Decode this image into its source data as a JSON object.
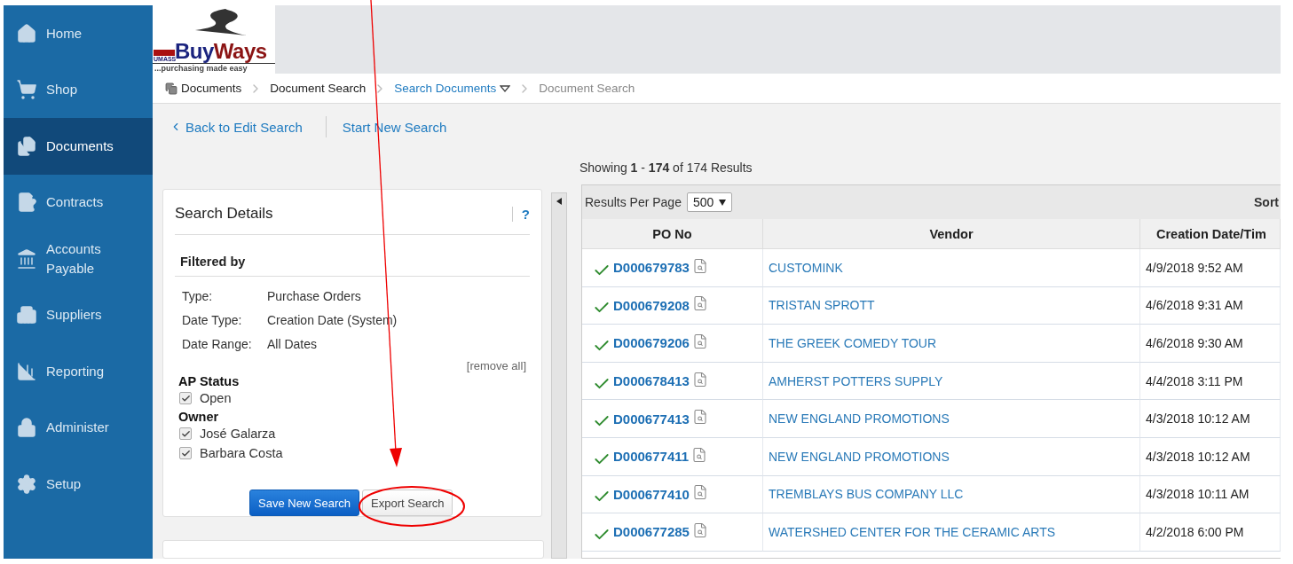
{
  "sidebar": {
    "items": [
      {
        "label": "Home",
        "selected": false
      },
      {
        "label": "Shop",
        "selected": false
      },
      {
        "label": "Documents",
        "selected": true
      },
      {
        "label": "Contracts",
        "selected": false
      },
      {
        "label": "Accounts Payable",
        "selected": false
      },
      {
        "label": "Suppliers",
        "selected": false
      },
      {
        "label": "Reporting",
        "selected": false
      },
      {
        "label": "Administer",
        "selected": false
      },
      {
        "label": "Setup",
        "selected": false
      }
    ]
  },
  "logo": {
    "mark": "UMASS",
    "name_1": "Buy",
    "name_2": "Ways",
    "tagline": "...purchasing made easy"
  },
  "breadcrumb": [
    {
      "label": "Documents",
      "kind": "root"
    },
    {
      "label": "Document Search",
      "kind": "plain"
    },
    {
      "label": "Search Documents",
      "kind": "menu"
    },
    {
      "label": "Document Search",
      "kind": "current"
    }
  ],
  "actions": {
    "back": "Back to Edit Search",
    "new": "Start New Search"
  },
  "search_details": {
    "title": "Search Details",
    "help": "?",
    "filtered_by": "Filtered by",
    "filters": [
      {
        "label": "Type:",
        "value": "Purchase Orders"
      },
      {
        "label": "Date Type:",
        "value": "Creation Date (System)"
      },
      {
        "label": "Date Range:",
        "value": "All Dates"
      }
    ],
    "remove_all": "[remove all]",
    "groups": [
      {
        "title": "AP Status",
        "options": [
          {
            "label": "Open",
            "checked": true
          }
        ]
      },
      {
        "title": "Owner",
        "options": [
          {
            "label": "José Galarza",
            "checked": true
          },
          {
            "label": "Barbara Costa",
            "checked": true
          }
        ]
      }
    ],
    "buttons": [
      {
        "label": "Save New Search",
        "kind": "primary"
      },
      {
        "label": "Export Search",
        "kind": "secondary"
      }
    ]
  },
  "results": {
    "summary": "Showing **1** - **174** of 174 Results",
    "per_page_label": "Results Per Page",
    "per_page": "500",
    "sort": "Sort",
    "columns": [
      "PO No",
      "Vendor",
      "Creation Date/Tim"
    ],
    "rows": [
      {
        "po": "D000679783",
        "vendor": "CUSTOMINK",
        "date": "4/9/2018 9:52 AM"
      },
      {
        "po": "D000679208",
        "vendor": "TRISTAN SPROTT",
        "date": "4/6/2018 9:31 AM"
      },
      {
        "po": "D000679206",
        "vendor": "THE GREEK COMEDY TOUR",
        "date": "4/6/2018 9:30 AM"
      },
      {
        "po": "D000678413",
        "vendor": "AMHERST POTTERS SUPPLY",
        "date": "4/4/2018 3:11 PM"
      },
      {
        "po": "D000677413",
        "vendor": "NEW ENGLAND PROMOTIONS",
        "date": "4/3/2018 10:12 AM"
      },
      {
        "po": "D000677411",
        "vendor": "NEW ENGLAND PROMOTIONS",
        "date": "4/3/2018 10:12 AM"
      },
      {
        "po": "D000677410",
        "vendor": "TREMBLAYS BUS COMPANY LLC",
        "date": "4/3/2018 10:11 AM"
      },
      {
        "po": "D000677285",
        "vendor": "WATERSHED CENTER FOR THE CERAMIC ARTS",
        "date": "4/2/2018 6:00 PM"
      }
    ]
  }
}
